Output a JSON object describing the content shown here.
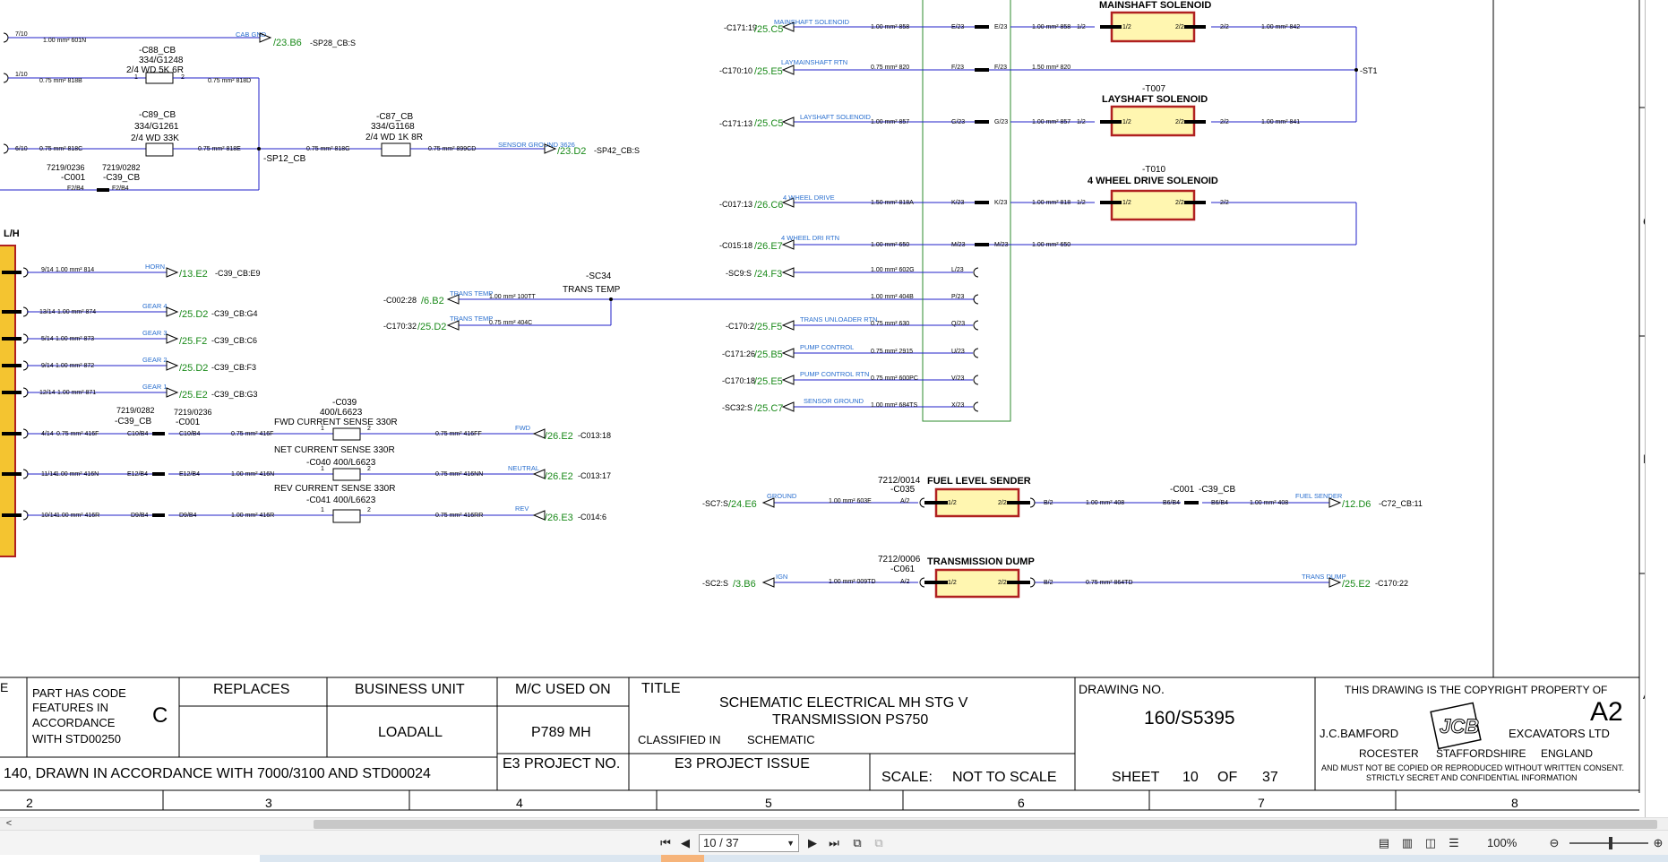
{
  "viewer": {
    "page_indicator": "10 / 37",
    "zoom": "100%"
  },
  "title_block": {
    "part_code_label": "PART HAS CODE FEATURES IN ACCORDANCE WITH STD00250",
    "part_code_line1": "PART HAS CODE",
    "part_code_line2": "FEATURES IN",
    "part_code_line3": "ACCORDANCE",
    "part_code_line4": "WITH STD00250",
    "part_code_value": "C",
    "cut_e": "E",
    "replaces_label": "REPLACES",
    "business_unit_label": "BUSINESS UNIT",
    "business_unit_value": "LOADALL",
    "mc_used_on_label": "M/C USED ON",
    "mc_used_on_value": "P789 MH",
    "title_label": "TITLE",
    "title_line1": "SCHEMATIC ELECTRICAL MH STG V",
    "title_line2": "TRANSMISSION PS750",
    "classified_label": "CLASSIFIED IN",
    "classified_value": "SCHEMATIC",
    "drawing_no_label": "DRAWING NO.",
    "drawing_no_value": "160/S5395",
    "drawn_in_accordance": "140, DRAWN IN ACCORDANCE WITH 7000/3100 AND STD00024",
    "e3_project_no_label": "E3 PROJECT NO.",
    "e3_project_issue_label": "E3 PROJECT ISSUE",
    "scale_label": "SCALE:",
    "scale_value": "NOT TO SCALE",
    "sheet_label": "SHEET",
    "sheet_value": "10",
    "of_label": "OF",
    "of_value": "37",
    "copyright_line": "THIS DRAWING IS THE COPYRIGHT PROPERTY OF",
    "size_code": "A2",
    "company_left": "J.C.BAMFORD",
    "company_right": "EXCAVATORS LTD",
    "town": "ROCESTER",
    "county": "STAFFORDSHIRE",
    "country": "ENGLAND",
    "notice_line1": "AND MUST NOT BE COPIED OR REPRODUCED WITHOUT WRITTEN CONSENT.",
    "notice_line2": "STRICTLY SECRET AND CONFIDENTIAL INFORMATION",
    "logo_text": "JCB"
  },
  "grid": {
    "columns": [
      "2",
      "3",
      "4",
      "5",
      "6",
      "7",
      "8"
    ],
    "rows": [
      "C",
      "B",
      "A"
    ]
  },
  "components": {
    "mainshaft": {
      "title": "MAINSHAFT SOLENOID"
    },
    "layshaft": {
      "ref": "-T007",
      "title": "LAYSHAFT SOLENOID"
    },
    "fwd": {
      "ref": "-T010",
      "title": "4 WHEEL DRIVE SOLENOID"
    },
    "fuel": {
      "part": "7212/0014",
      "ref": "-C035",
      "title": "FUEL LEVEL SENDER"
    },
    "dump": {
      "part": "7212/0006",
      "ref": "-C061",
      "title": "TRANSMISSION DUMP"
    },
    "pin1": "1/2",
    "pin2": "2/2",
    "c88": {
      "ref": "-C88_CB",
      "part": "334/G1248",
      "desc": "2/4 WD 5K 6R"
    },
    "c89": {
      "ref": "-C89_CB",
      "part": "334/G1261",
      "desc": "2/4 WD 33K"
    },
    "c87": {
      "ref": "-C87_CB",
      "part": "334/G1168",
      "desc": "2/4 WD 1K 8R"
    },
    "c039": {
      "ref": "-C039",
      "part": "400/L6623",
      "desc": "FWD CURRENT SENSE 330R"
    },
    "c040": {
      "desc": "NET CURRENT SENSE 330R",
      "ref": "-C040  400/L6623"
    },
    "c041": {
      "desc": "REV CURRENT SENSE 330R",
      "ref": "-C041  400/L6623"
    },
    "sc34": {
      "ref": "-SC34",
      "desc": "TRANS TEMP"
    },
    "lh_label": "L/H"
  },
  "labels": {
    "sp12": "-SP12_CB",
    "st1": "-ST1",
    "conn_7219_0236": "7219/0236",
    "conn_7219_0282": "7219/0282",
    "c001": "-C001",
    "c39cb": "-C39_CB",
    "f2b4": "F2/B4",
    "c10b4": "C10/B4",
    "e12b4": "E12/B4",
    "d9b4": "D9/B4",
    "b6b4": "B6/B4",
    "top_710": "7/10",
    "w_601n": "1.00 mm² 601N",
    "cab_gnd": "CAB GND",
    "ref_23b6": "/23.B6",
    "sp28": "-SP28_CB:S",
    "p_1_10": "1/10",
    "w_818b": "0.75 mm²  818B",
    "w_818d": "0.75 mm²  818D",
    "p_6_10": "6/10",
    "w_818c": "0.75 mm²  818C",
    "w_818e": "0.75 mm²  818E",
    "w_818g": "0.75 mm²  818G",
    "w_899cd": "0.75 mm²  899CD",
    "sensor_ground_3626": "SENSOR GROUND 3626",
    "ref_23d2": "/23.D2",
    "sp42": "-SP42_CB:S",
    "n1": "1",
    "n2": "2",
    "horn": "HORN",
    "ref_13e2": "/13.E2",
    "c39_e9": "-C39_CB:E9",
    "gear4": "GEAR 4",
    "ref_25d2": "/25.D2",
    "c39_g4": "-C39_CB:G4",
    "gear3": "GEAR 3",
    "ref_25f2": "/25.F2",
    "c39_c6": "-C39_CB:C6",
    "gear2": "GEAR 2",
    "c39_f3": "-C39_CB:F3",
    "gear1": "GEAR 1",
    "ref_25e2": "/25.E2",
    "c39_g3": "-C39_CB:G3",
    "fwd": "FWD",
    "ref_26e2": "/26.E2",
    "c013_18": "-C013:18",
    "neutral": "NEUTRAL",
    "c013_17": "-C013:17",
    "rev": "REV",
    "ref_26e3": "/26.E3",
    "c014_6": "-C014:6",
    "c002_28": "-C002:28",
    "ref_6b2": "/6.B2",
    "trans_temp": "TRANS TEMP",
    "w_100tt": "1.00 mm²  100TT",
    "c170_32": "-C170:32",
    "w_404c": "0.75 mm²  404C",
    "c171_19": "-C171:19",
    "ref_25c5": "/25.C5",
    "mainshaft_solenoid": "MAINSHAFT SOLENOID",
    "w_858": "1.00 mm²  858",
    "c170_10": "-C170:10",
    "ref_25e5": "/25.E5",
    "layshaft_rtn": "LAYMAINSHAFT RTN",
    "w_820": "0.75 mm²  820",
    "c171_13": "-C171:13",
    "layshaft_solenoid": "LAYSHAFT SOLENOID",
    "w_857": "1.00 mm²  857",
    "c017_13": "-C017:13",
    "ref_26c6": "/26.C6",
    "wheel_drive": "4 WHEEL DRIVE",
    "w_818a": "1.50 mm²  818A",
    "c015_18": "-C015:18",
    "ref_26e7": "/26.E7",
    "wheel_drive_rtn": "4 WHEEL DRI RTN",
    "w_650": "1.00 mm²  650",
    "sc9": "-SC9:S",
    "ref_24f3": "/24.F3",
    "w_602g": "1.00 mm²  602G",
    "w_404b": "1.00 mm²  404B",
    "c170_2": "-C170:2",
    "ref_25f5": "/25.F5",
    "trans_unloader_rtn": "TRANS UNLOADER RTN",
    "w_630": "0.75 mm²  630",
    "c171_26": "-C171:26",
    "ref_25b5": "/25.B5",
    "pump_control": "PUMP CONTROL",
    "w_2915": "0.75 mm²  2915",
    "c170_18": "-C170:18",
    "pump_control_rtn": "PUMP CONTROL RTN",
    "w_600pc": "0.75 mm²  600PC",
    "sc32": "-SC32:S",
    "ref_25c7": "/25.C7",
    "sensor_ground": "SENSOR GROUND",
    "w_684ts": "1.00 mm²  684TS",
    "sc7": "-SC7:S",
    "ref_24e6": "/24.E6",
    "ground": "GROUND",
    "w_603e": "1.00 mm²  603E",
    "w_408": "1.00 mm²  408",
    "fuel_sender": "FUEL SENDER",
    "ref_12d6": "/12.D6",
    "c72_11": "-C72_CB:11",
    "sc2": "-SC2:S",
    "ref_3b6": "/3.B6",
    "ign": "IGN",
    "w_009td": "1.00 mm²  009TD",
    "w_864td": "0.75 mm²  864TD",
    "trans_dump": "TRANS DUMP",
    "c170_22": "-C170:22",
    "a2": "A/2",
    "b2": "B/2",
    "e_f23": "E/23",
    "f_f23": "F/23",
    "g_f23": "G/23",
    "k_f23": "K/23",
    "m_f23": "M/23",
    "l_f23": "L/23",
    "p_f23": "P/23",
    "q_f23": "Q/23",
    "u_f23": "U/23",
    "v_f23": "V/23",
    "x_f23": "X/23",
    "w_858b": "1.00 mm²  858",
    "w_820b": "1.50 mm²  820",
    "w_857b": "1.00 mm²  857",
    "w_818": "1.00 mm²  818",
    "w_650b": "1.00 mm²  650",
    "w_842": "1.00 mm²  842",
    "w_841": "1.00 mm²  841",
    "p9_14": "9/14",
    "p13_14": "13/14",
    "p5_14": "5/14",
    "p9_14b": "9/14",
    "p12_14": "12/14",
    "p4_14": "4/14",
    "p11_14": "11/14",
    "p10_14": "10/14",
    "w_814": "1.00 mm²  814",
    "w_874": "1.00 mm²  874",
    "w_873": "1.00 mm²  873",
    "w_872": "1.00 mm²  872",
    "w_871": "1.00 mm²  871",
    "w_416f": "0.75 mm²  416F",
    "w_416n": "1.00 mm²  416N",
    "w_416r": "1.00 mm²  416R",
    "w_416ff": "0.75 mm²  416FF",
    "w_416nn": "0.75 mm²  416NN",
    "w_416rr": "0.75 mm²  416RR"
  },
  "colors": {
    "wire": "#2020c8",
    "label_blue": "#2a6fcf",
    "ref_green": "#1a8a1a",
    "component_fill": "#fff6b0",
    "component_border": "#b02020",
    "bus_green": "#2e8b2e",
    "harness_fill": "#f4c430"
  }
}
